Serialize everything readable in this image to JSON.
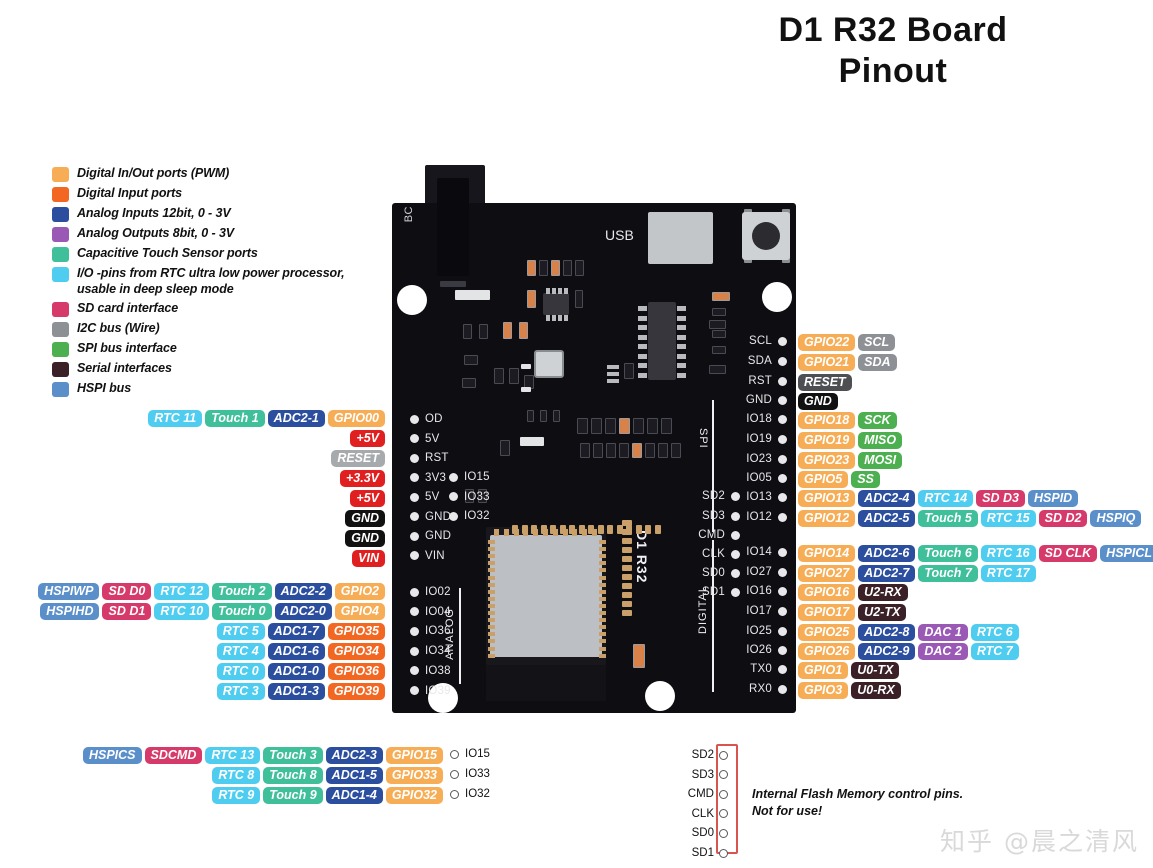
{
  "title": {
    "line1": "D1 R32 Board",
    "line2": "Pinout"
  },
  "watermark": "知乎 @晨之清风",
  "colors": {
    "gpio_pwm": "#f6ad55",
    "digital_input": "#f26722",
    "adc": "#2b4f9e",
    "dac": "#9b59b6",
    "touch": "#3fbf9a",
    "rtc": "#4ecdf0",
    "sd": "#d63a6a",
    "i2c": "#8d9196",
    "spi": "#4caf50",
    "serial": "#3b2028",
    "hspi": "#5b8fc9",
    "power_red": "#e02020",
    "gnd_black": "#111111",
    "reset_gray": "#a7aaad"
  },
  "legend": {
    "items": [
      {
        "color": "#f6ad55",
        "label": "Digital In/Out ports (PWM)"
      },
      {
        "color": "#f26722",
        "label": "Digital Input ports"
      },
      {
        "color": "#2b4f9e",
        "label": "Analog Inputs 12bit, 0 - 3V"
      },
      {
        "color": "#9b59b6",
        "label": "Analog Outputs 8bit, 0 - 3V"
      },
      {
        "color": "#3fbf9a",
        "label": "Capacitive Touch Sensor ports"
      },
      {
        "color": "#4ecdf0",
        "label": "I/O -pins from RTC ultra low power processor, usable in deep sleep mode"
      },
      {
        "color": "#d63a6a",
        "label": "SD card interface"
      },
      {
        "color": "#8d9196",
        "label": "I2C bus (Wire)"
      },
      {
        "color": "#4caf50",
        "label": "SPI bus interface"
      },
      {
        "color": "#3b2028",
        "label": "Serial interfaces"
      },
      {
        "color": "#5b8fc9",
        "label": "HSPI bus"
      }
    ]
  },
  "board": {
    "silk_bc": "BC",
    "silk_usb": "USB",
    "silk_module": "D1 R32",
    "silk_analog": "ANALOG",
    "silk_spi": "SPI",
    "silk_digital": "DIGITAL",
    "left_header_col1": [
      "OD",
      "5V",
      "RST",
      "3V3",
      "5V",
      "GND",
      "GND",
      "VIN"
    ],
    "left_header_col2": [
      "IO15",
      "IO33",
      "IO32"
    ],
    "left_header_analog": [
      "IO02",
      "IO04",
      "IO36",
      "IO34",
      "IO38",
      "IO39"
    ],
    "right_header_flash": [
      "SD2",
      "SD3",
      "CMD",
      "CLK",
      "SD0",
      "SD1"
    ],
    "right_header_main": [
      "SCL",
      "SDA",
      "RST",
      "GND",
      "IO18",
      "IO19",
      "IO23",
      "IO05",
      "IO13",
      "IO12",
      "IO14",
      "IO27",
      "IO16",
      "IO17",
      "IO25",
      "IO26",
      "TX0",
      "RX0"
    ]
  },
  "left_top_rows": [
    {
      "pin": "OD",
      "tags": [
        {
          "t": "RTC 11",
          "c": "#4ecdf0"
        },
        {
          "t": "Touch 1",
          "c": "#3fbf9a"
        },
        {
          "t": "ADC2-1",
          "c": "#2b4f9e"
        },
        {
          "t": "GPIO00",
          "c": "#f6ad55"
        }
      ]
    },
    {
      "pin": "5V",
      "tags": [
        {
          "t": "+5V",
          "c": "#e02020"
        }
      ]
    },
    {
      "pin": "RST",
      "tags": [
        {
          "t": "RESET",
          "c": "#a7aaad"
        }
      ]
    },
    {
      "pin": "3V3",
      "tags": [
        {
          "t": "+3.3V",
          "c": "#e02020"
        }
      ]
    },
    {
      "pin": "5V",
      "tags": [
        {
          "t": "+5V",
          "c": "#e02020"
        }
      ]
    },
    {
      "pin": "GND",
      "tags": [
        {
          "t": "GND",
          "c": "#111111"
        }
      ]
    },
    {
      "pin": "GND",
      "tags": [
        {
          "t": "GND",
          "c": "#111111"
        }
      ]
    },
    {
      "pin": "VIN",
      "tags": [
        {
          "t": "VIN",
          "c": "#e02020"
        }
      ]
    }
  ],
  "left_analog_rows": [
    {
      "pin": "IO02",
      "tags": [
        {
          "t": "HSPIWP",
          "c": "#5b8fc9"
        },
        {
          "t": "SD D0",
          "c": "#d63a6a"
        },
        {
          "t": "RTC 12",
          "c": "#4ecdf0"
        },
        {
          "t": "Touch 2",
          "c": "#3fbf9a"
        },
        {
          "t": "ADC2-2",
          "c": "#2b4f9e"
        },
        {
          "t": "GPIO2",
          "c": "#f6ad55"
        }
      ]
    },
    {
      "pin": "IO04",
      "tags": [
        {
          "t": "HSPIHD",
          "c": "#5b8fc9"
        },
        {
          "t": "SD D1",
          "c": "#d63a6a"
        },
        {
          "t": "RTC 10",
          "c": "#4ecdf0"
        },
        {
          "t": "Touch 0",
          "c": "#3fbf9a"
        },
        {
          "t": "ADC2-0",
          "c": "#2b4f9e"
        },
        {
          "t": "GPIO4",
          "c": "#f6ad55"
        }
      ]
    },
    {
      "pin": "IO36",
      "tags": [
        {
          "t": "RTC 5",
          "c": "#4ecdf0"
        },
        {
          "t": "ADC1-7",
          "c": "#2b4f9e"
        },
        {
          "t": "GPIO35",
          "c": "#f26722"
        }
      ]
    },
    {
      "pin": "IO34",
      "tags": [
        {
          "t": "RTC 4",
          "c": "#4ecdf0"
        },
        {
          "t": "ADC1-6",
          "c": "#2b4f9e"
        },
        {
          "t": "GPIO34",
          "c": "#f26722"
        }
      ]
    },
    {
      "pin": "IO38",
      "tags": [
        {
          "t": "RTC 0",
          "c": "#4ecdf0"
        },
        {
          "t": "ADC1-0",
          "c": "#2b4f9e"
        },
        {
          "t": "GPIO36",
          "c": "#f26722"
        }
      ]
    },
    {
      "pin": "IO39",
      "tags": [
        {
          "t": "RTC 3",
          "c": "#4ecdf0"
        },
        {
          "t": "ADC1-3",
          "c": "#2b4f9e"
        },
        {
          "t": "GPIO39",
          "c": "#f26722"
        }
      ]
    }
  ],
  "right_rows": [
    {
      "pin": "SCL",
      "tags": [
        {
          "t": "GPIO22",
          "c": "#f6ad55"
        },
        {
          "t": "SCL",
          "c": "#8d9196"
        }
      ]
    },
    {
      "pin": "SDA",
      "tags": [
        {
          "t": "GPIO21",
          "c": "#f6ad55"
        },
        {
          "t": "SDA",
          "c": "#8d9196"
        }
      ]
    },
    {
      "pin": "RST",
      "tags": [
        {
          "t": "RESET",
          "c": "#4d4f52"
        }
      ]
    },
    {
      "pin": "GND",
      "tags": [
        {
          "t": "GND",
          "c": "#111111"
        }
      ]
    },
    {
      "pin": "IO18",
      "tags": [
        {
          "t": "GPIO18",
          "c": "#f6ad55"
        },
        {
          "t": "SCK",
          "c": "#4caf50"
        }
      ]
    },
    {
      "pin": "IO19",
      "tags": [
        {
          "t": "GPIO19",
          "c": "#f6ad55"
        },
        {
          "t": "MISO",
          "c": "#4caf50"
        }
      ]
    },
    {
      "pin": "IO23",
      "tags": [
        {
          "t": "GPIO23",
          "c": "#f6ad55"
        },
        {
          "t": "MOSI",
          "c": "#4caf50"
        }
      ]
    },
    {
      "pin": "IO05",
      "tags": [
        {
          "t": "GPIO5",
          "c": "#f6ad55"
        },
        {
          "t": "SS",
          "c": "#4caf50"
        }
      ]
    },
    {
      "pin": "IO13",
      "tags": [
        {
          "t": "GPIO13",
          "c": "#f6ad55"
        },
        {
          "t": "ADC2-4",
          "c": "#2b4f9e"
        },
        {
          "t": "RTC 14",
          "c": "#4ecdf0"
        },
        {
          "t": "SD D3",
          "c": "#d63a6a"
        },
        {
          "t": "HSPID",
          "c": "#5b8fc9"
        }
      ]
    },
    {
      "pin": "IO12",
      "tags": [
        {
          "t": "GPIO12",
          "c": "#f6ad55"
        },
        {
          "t": "ADC2-5",
          "c": "#2b4f9e"
        },
        {
          "t": "Touch 5",
          "c": "#3fbf9a"
        },
        {
          "t": "RTC 15",
          "c": "#4ecdf0"
        },
        {
          "t": "SD D2",
          "c": "#d63a6a"
        },
        {
          "t": "HSPIQ",
          "c": "#5b8fc9"
        }
      ]
    },
    {
      "pin": "IO14",
      "tags": [
        {
          "t": "GPIO14",
          "c": "#f6ad55"
        },
        {
          "t": "ADC2-6",
          "c": "#2b4f9e"
        },
        {
          "t": "Touch 6",
          "c": "#3fbf9a"
        },
        {
          "t": "RTC 16",
          "c": "#4ecdf0"
        },
        {
          "t": "SD CLK",
          "c": "#d63a6a"
        },
        {
          "t": "HSPICL",
          "c": "#5b8fc9"
        }
      ]
    },
    {
      "pin": "IO27",
      "tags": [
        {
          "t": "GPIO27",
          "c": "#f6ad55"
        },
        {
          "t": "ADC2-7",
          "c": "#2b4f9e"
        },
        {
          "t": "Touch 7",
          "c": "#3fbf9a"
        },
        {
          "t": "RTC 17",
          "c": "#4ecdf0"
        }
      ]
    },
    {
      "pin": "IO16",
      "tags": [
        {
          "t": "GPIO16",
          "c": "#f6ad55"
        },
        {
          "t": "U2-RX",
          "c": "#3b2028"
        }
      ]
    },
    {
      "pin": "IO17",
      "tags": [
        {
          "t": "GPIO17",
          "c": "#f6ad55"
        },
        {
          "t": "U2-TX",
          "c": "#3b2028"
        }
      ]
    },
    {
      "pin": "IO25",
      "tags": [
        {
          "t": "GPIO25",
          "c": "#f6ad55"
        },
        {
          "t": "ADC2-8",
          "c": "#2b4f9e"
        },
        {
          "t": "DAC 1",
          "c": "#9b59b6"
        },
        {
          "t": "RTC 6",
          "c": "#4ecdf0"
        }
      ]
    },
    {
      "pin": "IO26",
      "tags": [
        {
          "t": "GPIO26",
          "c": "#f6ad55"
        },
        {
          "t": "ADC2-9",
          "c": "#2b4f9e"
        },
        {
          "t": "DAC 2",
          "c": "#9b59b6"
        },
        {
          "t": "RTC 7",
          "c": "#4ecdf0"
        }
      ]
    },
    {
      "pin": "TX0",
      "tags": [
        {
          "t": "GPIO1",
          "c": "#f6ad55"
        },
        {
          "t": "U0-TX",
          "c": "#3b2028"
        }
      ]
    },
    {
      "pin": "RX0",
      "tags": [
        {
          "t": "GPIO3",
          "c": "#f6ad55"
        },
        {
          "t": "U0-RX",
          "c": "#3b2028"
        }
      ]
    }
  ],
  "bottom_rows": [
    {
      "pin": "IO15",
      "tags": [
        {
          "t": "HSPICS",
          "c": "#5b8fc9"
        },
        {
          "t": "SDCMD",
          "c": "#d63a6a"
        },
        {
          "t": "RTC 13",
          "c": "#4ecdf0"
        },
        {
          "t": "Touch 3",
          "c": "#3fbf9a"
        },
        {
          "t": "ADC2-3",
          "c": "#2b4f9e"
        },
        {
          "t": "GPIO15",
          "c": "#f6ad55"
        }
      ]
    },
    {
      "pin": "IO33",
      "tags": [
        {
          "t": "RTC 8",
          "c": "#4ecdf0"
        },
        {
          "t": "Touch 8",
          "c": "#3fbf9a"
        },
        {
          "t": "ADC1-5",
          "c": "#2b4f9e"
        },
        {
          "t": "GPIO33",
          "c": "#f6ad55"
        }
      ]
    },
    {
      "pin": "IO32",
      "tags": [
        {
          "t": "RTC 9",
          "c": "#4ecdf0"
        },
        {
          "t": "Touch 9",
          "c": "#3fbf9a"
        },
        {
          "t": "ADC1-4",
          "c": "#2b4f9e"
        },
        {
          "t": "GPIO32",
          "c": "#f6ad55"
        }
      ]
    }
  ],
  "flash": {
    "pins": [
      "SD2",
      "SD3",
      "CMD",
      "CLK",
      "SD0",
      "SD1"
    ],
    "note_line1": "Internal Flash Memory control pins.",
    "note_line2": "Not for use!"
  }
}
